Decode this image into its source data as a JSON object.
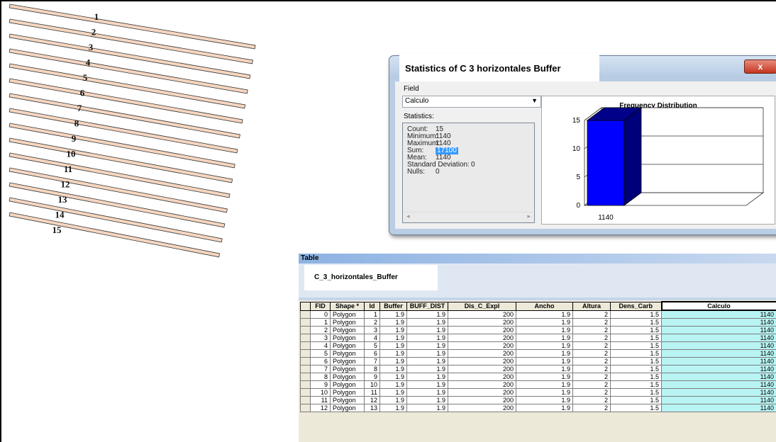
{
  "map": {
    "strip_labels": [
      "1",
      "2",
      "3",
      "4",
      "5",
      "6",
      "7",
      "8",
      "9",
      "10",
      "11",
      "12",
      "13",
      "14",
      "15"
    ],
    "strip_color": "#f5d6c0"
  },
  "stats_window": {
    "title": "Statistics of C  3  horizontales  Buffer",
    "close_label": "x",
    "field_label": "Field",
    "field_value": "Calculo",
    "statistics_label": "Statistics:",
    "stats": [
      {
        "label": "Count:",
        "value": "15"
      },
      {
        "label": "Minimum:",
        "value": "1140"
      },
      {
        "label": "Maximum:",
        "value": "1140"
      },
      {
        "label": "Sum:",
        "value": "17100"
      },
      {
        "label": "Mean:",
        "value": "1140"
      },
      {
        "label": "Standard Deviation:",
        "value": "0"
      },
      {
        "label": "Nulls:",
        "value": "0"
      }
    ],
    "sum_highlight_color": "#3399ff"
  },
  "chart_data": {
    "type": "bar",
    "title": "Frequency Distribution",
    "categories": [
      "1140"
    ],
    "values": [
      15
    ],
    "ylim": [
      0,
      15
    ],
    "yticks": [
      0,
      5,
      10,
      15
    ],
    "xlabel": "",
    "ylabel": "",
    "bar_color": "#0000ff",
    "grid": true
  },
  "table_window": {
    "title": "Table",
    "table_name": "C_3_horizontales_Buffer",
    "columns": [
      "FID",
      "Shape *",
      "Id",
      "Buffer",
      "BUFF_DIST",
      "Dis_C_Expl",
      "Ancho",
      "Altura",
      "Dens_Carb",
      "Calculo"
    ],
    "rows": [
      [
        "0",
        "Polygon",
        "1",
        "1.9",
        "1.9",
        "200",
        "1.9",
        "2",
        "1.5",
        "1140"
      ],
      [
        "1",
        "Polygon",
        "2",
        "1.9",
        "1.9",
        "200",
        "1.9",
        "2",
        "1.5",
        "1140"
      ],
      [
        "2",
        "Polygon",
        "3",
        "1.9",
        "1.9",
        "200",
        "1.9",
        "2",
        "1.5",
        "1140"
      ],
      [
        "3",
        "Polygon",
        "4",
        "1.9",
        "1.9",
        "200",
        "1.9",
        "2",
        "1.5",
        "1140"
      ],
      [
        "4",
        "Polygon",
        "5",
        "1.9",
        "1.9",
        "200",
        "1.9",
        "2",
        "1.5",
        "1140"
      ],
      [
        "5",
        "Polygon",
        "6",
        "1.9",
        "1.9",
        "200",
        "1.9",
        "2",
        "1.5",
        "1140"
      ],
      [
        "6",
        "Polygon",
        "7",
        "1.9",
        "1.9",
        "200",
        "1.9",
        "2",
        "1.5",
        "1140"
      ],
      [
        "7",
        "Polygon",
        "8",
        "1.9",
        "1.9",
        "200",
        "1.9",
        "2",
        "1.5",
        "1140"
      ],
      [
        "8",
        "Polygon",
        "9",
        "1.9",
        "1.9",
        "200",
        "1.9",
        "2",
        "1.5",
        "1140"
      ],
      [
        "9",
        "Polygon",
        "10",
        "1.9",
        "1.9",
        "200",
        "1.9",
        "2",
        "1.5",
        "1140"
      ],
      [
        "10",
        "Polygon",
        "11",
        "1.9",
        "1.9",
        "200",
        "1.9",
        "2",
        "1.5",
        "1140"
      ],
      [
        "11",
        "Polygon",
        "12",
        "1.9",
        "1.9",
        "200",
        "1.9",
        "2",
        "1.5",
        "1140"
      ],
      [
        "12",
        "Polygon",
        "13",
        "1.9",
        "1.9",
        "200",
        "1.9",
        "2",
        "1.5",
        "1140"
      ]
    ],
    "highlight_color": "#b8f4f4"
  }
}
